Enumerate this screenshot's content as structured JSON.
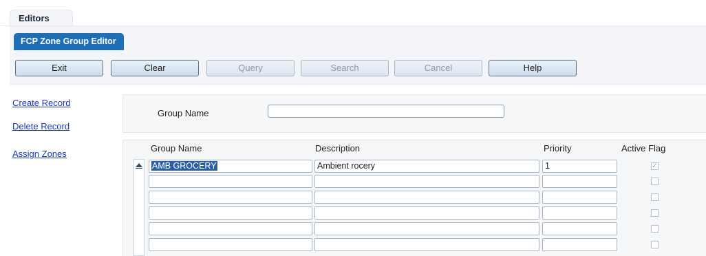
{
  "tabs": {
    "main": "Editors",
    "sub": "FCP Zone Group Editor"
  },
  "toolbar": {
    "exit": "Exit",
    "clear": "Clear",
    "query": "Query",
    "search": "Search",
    "cancel": "Cancel",
    "help": "Help"
  },
  "actions": {
    "create": "Create Record",
    "delete": "Delete Record",
    "assign": "Assign Zones"
  },
  "search": {
    "label": "Group Name",
    "value": ""
  },
  "grid": {
    "headers": {
      "group_name": "Group Name",
      "description": "Description",
      "priority": "Priority",
      "active": "Active Flag"
    },
    "rows": [
      {
        "group_name": "AMB GROCERY",
        "description": "Ambient rocery",
        "priority": "1",
        "active": true
      },
      {
        "group_name": "",
        "description": "",
        "priority": "",
        "active": false
      },
      {
        "group_name": "",
        "description": "",
        "priority": "",
        "active": false
      },
      {
        "group_name": "",
        "description": "",
        "priority": "",
        "active": false
      },
      {
        "group_name": "",
        "description": "",
        "priority": "",
        "active": false
      },
      {
        "group_name": "",
        "description": "",
        "priority": "",
        "active": false
      }
    ]
  }
}
